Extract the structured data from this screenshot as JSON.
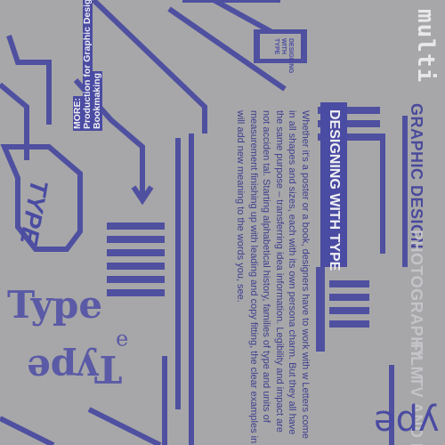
{
  "brand": "multi",
  "menu": {
    "graphic_design": "GRAPHIC DESIGN",
    "photography": "PHOTOGRAPHY",
    "film": "FILM",
    "tv": "TV AND M"
  },
  "title": "DESIGNING WITH TYPE",
  "small_label": "DESIGNING\nWITH\nTYPE",
  "body": "Whether it's a poster or a book, designers have to work with w Letters come in all shapes and sizes, each with its own persona charm. But they all have the same purpose – transferring idea information. Legibility and impact are not acciden tal. Starting alphabetical history, families of type and units of measurement finishing up with leading and copy fitting, the clear examples in will add new meaning to the words you, see.",
  "more": {
    "heading": "MORE:",
    "line1": "Production for Graphic Designer",
    "line2": "Bookmaking"
  },
  "type_words": {
    "italic": "TYPE",
    "serif_large": "Type",
    "serif_flipped": "Type",
    "serif_small_flipped": "ə",
    "big_flipped": "ədʎ"
  },
  "colors": {
    "background": "#a7a7a9",
    "accent": "#4a4ba2",
    "muted": "#c4c4c8",
    "light": "#e8e8ea"
  }
}
